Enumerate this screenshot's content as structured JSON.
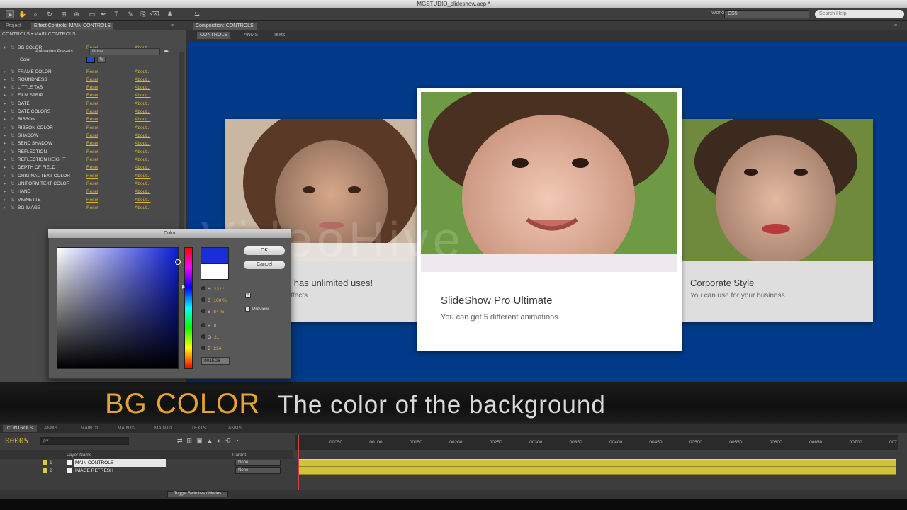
{
  "window_title": "MGSTUDIO_slideshow.aep *",
  "workspace": {
    "label": "Workspace:",
    "value": "CS5",
    "search_placeholder": "Search Help"
  },
  "left_panel": {
    "tabs": [
      "Project",
      "Effect Controls: MAIN CONTROLS",
      "≡"
    ],
    "path": "CONTROLS • MAIN CONTROLS",
    "effects": [
      {
        "name": "BG COLOR",
        "reset": "Reset",
        "about": "About..."
      },
      {
        "name": "FRAME COLOR",
        "reset": "Reset",
        "about": "About..."
      },
      {
        "name": "ROUNDNESS",
        "reset": "Reset",
        "about": "About..."
      },
      {
        "name": "LITTLE TAB",
        "reset": "Reset",
        "about": "About..."
      },
      {
        "name": "FILM STRIP",
        "reset": "Reset",
        "about": "About..."
      },
      {
        "name": "DATE",
        "reset": "Reset",
        "about": "About..."
      },
      {
        "name": "DATE COLORS",
        "reset": "Reset",
        "about": "About..."
      },
      {
        "name": "RIBBON",
        "reset": "Reset",
        "about": "About..."
      },
      {
        "name": "RIBBON COLOR",
        "reset": "Reset",
        "about": "About..."
      },
      {
        "name": "SHADOW",
        "reset": "Reset",
        "about": "About..."
      },
      {
        "name": "SEND SHADOW",
        "reset": "Reset",
        "about": "About..."
      },
      {
        "name": "REFLECTION",
        "reset": "Reset",
        "about": "About..."
      },
      {
        "name": "REFLECTION HEIGHT",
        "reset": "Reset",
        "about": "About..."
      },
      {
        "name": "DEPTH OF FIELD",
        "reset": "Reset",
        "about": "About..."
      },
      {
        "name": "ORIGINAL TEXT COLOR",
        "reset": "Reset",
        "about": "About..."
      },
      {
        "name": "UNIFORM TEXT COLOR",
        "reset": "Reset",
        "about": "About..."
      },
      {
        "name": "HAND",
        "reset": "Reset",
        "about": "About..."
      },
      {
        "name": "VIGNETTE",
        "reset": "Reset",
        "about": "About..."
      },
      {
        "name": "BG IMAGE",
        "reset": "Reset",
        "about": "About..."
      }
    ],
    "animation_presets_label": "Animation Presets:",
    "animation_presets_value": "None",
    "color_label": "Color"
  },
  "composition": {
    "tabs": [
      "Composition: CONTROLS",
      "≡"
    ],
    "subtabs": [
      "CONTROLS",
      "ANMS",
      "Texts"
    ],
    "bg_color": "#003a88",
    "cards": [
      {
        "title": "SlideShow Pro Ultimate",
        "subtitle": "You can get 5 different animations"
      },
      {
        "title": "...r has unlimited uses!",
        "subtitle": "...ffects"
      },
      {
        "title": "Corporate Style",
        "subtitle": "You can use for your business"
      }
    ],
    "watermark": "VideoHive"
  },
  "caption": {
    "key": "BG COLOR",
    "description": "The color of the background"
  },
  "color_dialog": {
    "title": "Color",
    "ok": "OK",
    "cancel": "Cancel",
    "preview": "Preview",
    "fields": [
      {
        "label": "H",
        "value": "232 °"
      },
      {
        "label": "S",
        "value": "100 %"
      },
      {
        "label": "B",
        "value": "84 %"
      },
      {
        "label": "R",
        "value": "0"
      },
      {
        "label": "G",
        "value": "21"
      },
      {
        "label": "B",
        "value": "214"
      }
    ],
    "hex": "0015D6",
    "new_color": "#1a2ed8",
    "current_color": "#ffffff"
  },
  "timeline": {
    "tabs": [
      "CONTROLS",
      "ANMS",
      "MAIN 01",
      "MAIN 02",
      "MAIN 03",
      "TEXTS",
      "ANMS"
    ],
    "timecode": "00005",
    "search_placeholder": "ρ▾",
    "header": {
      "col_source": "Layer Name",
      "col_parent": "Parent"
    },
    "ruler": [
      "00050",
      "00100",
      "00150",
      "00200",
      "00250",
      "00300",
      "00350",
      "00400",
      "00450",
      "00500",
      "00550",
      "00600",
      "00650",
      "00700",
      "007"
    ],
    "layers": [
      {
        "num": "1",
        "name": "MAIN CONTROLS",
        "parent": "None"
      },
      {
        "num": "2",
        "name": "IMAGE REFRESH",
        "parent": "None"
      }
    ],
    "toggle": "Toggle Switches / Modes",
    "bar_color": "#cfc33a"
  }
}
